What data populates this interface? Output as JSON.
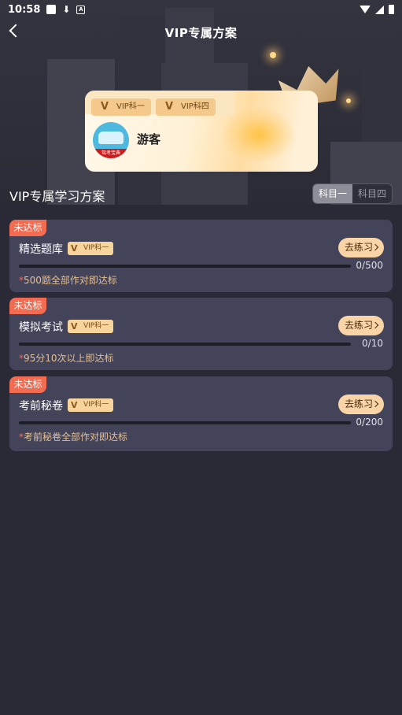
{
  "status": {
    "time": "10:58"
  },
  "header": {
    "title": "VIP专属方案"
  },
  "card": {
    "badges": [
      "VIP科一",
      "VIP科四"
    ],
    "avatar_caption": "驾考宝典",
    "username": "游客"
  },
  "section": {
    "title": "VIP专属学习方案"
  },
  "tabs": [
    {
      "label": "科目一",
      "active": true
    },
    {
      "label": "科目四",
      "active": false
    }
  ],
  "plans": [
    {
      "flag": "未达标",
      "name": "精选题库",
      "badge": "VIP科一",
      "button": "去练习",
      "count": "0/500",
      "progress": 0,
      "hint": "500题全部作对即达标"
    },
    {
      "flag": "未达标",
      "name": "模拟考试",
      "badge": "VIP科一",
      "button": "去练习",
      "count": "0/10",
      "progress": 0,
      "hint": "95分10次以上即达标"
    },
    {
      "flag": "未达标",
      "name": "考前秘卷",
      "badge": "VIP科一",
      "button": "去练习",
      "count": "0/200",
      "progress": 0,
      "hint": "考前秘卷全部作对即达标"
    }
  ],
  "colors": {
    "background": "#2a2a36",
    "card": "#43435a",
    "flag": "#f36c51",
    "gold": "#f8d4a6",
    "hint": "#e6c08f"
  }
}
